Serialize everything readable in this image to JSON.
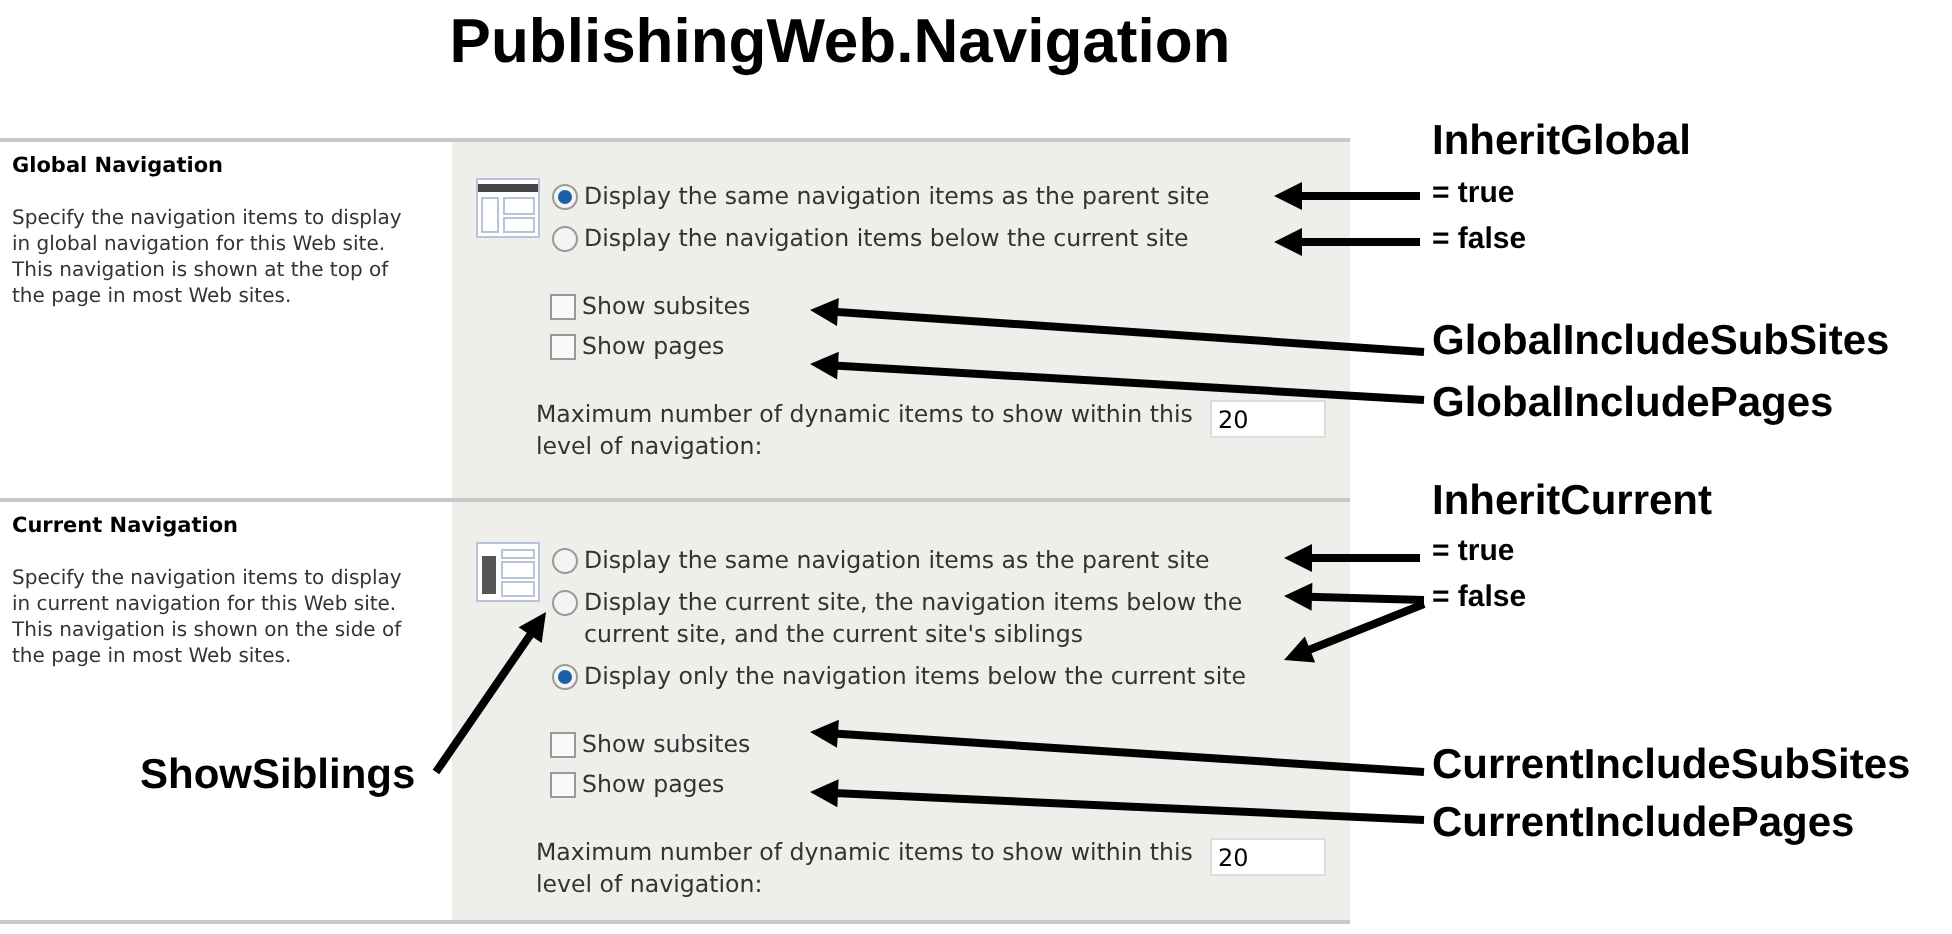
{
  "title": "PublishingWeb.Navigation",
  "sections": [
    {
      "kind": "global",
      "heading": "Global Navigation",
      "description": "Specify the navigation items to display in global navigation for this Web site. This navigation is shown at the top of the page in most Web sites.",
      "options": [
        {
          "label": "Display the same navigation items as the parent site",
          "selected": true
        },
        {
          "label": "Display the navigation items below the current site",
          "selected": false
        }
      ],
      "checkboxes": [
        {
          "label": "Show subsites",
          "checked": false
        },
        {
          "label": "Show pages",
          "checked": false
        }
      ],
      "max_items": {
        "label": "Maximum number of dynamic items to show within this level of navigation:",
        "value": "20"
      }
    },
    {
      "kind": "current",
      "heading": "Current Navigation",
      "description": "Specify the navigation items to display in current navigation for this Web site. This navigation is shown on the side of the page in most Web sites.",
      "options": [
        {
          "label": "Display the same navigation items as the parent site",
          "selected": false
        },
        {
          "label": "Display the current site, the navigation items below the current site, and the current site's siblings",
          "selected": false
        },
        {
          "label": "Display only the navigation items below the current site",
          "selected": true
        }
      ],
      "checkboxes": [
        {
          "label": "Show subsites",
          "checked": false
        },
        {
          "label": "Show pages",
          "checked": false
        }
      ],
      "max_items": {
        "label": "Maximum number of dynamic items to show within this level of navigation:",
        "value": "20"
      }
    }
  ],
  "annotations": [
    {
      "text": "InheritGlobal",
      "kind": "property"
    },
    {
      "text": "= true",
      "kind": "value"
    },
    {
      "text": "= false",
      "kind": "value"
    },
    {
      "text": "GlobalIncludeSubSites",
      "kind": "property"
    },
    {
      "text": "GlobalIncludePages",
      "kind": "property"
    },
    {
      "text": "InheritCurrent",
      "kind": "property"
    },
    {
      "text": "= true",
      "kind": "value"
    },
    {
      "text": "= false",
      "kind": "value"
    },
    {
      "text": "ShowSiblings",
      "kind": "callout"
    },
    {
      "text": "CurrentIncludeSubSites",
      "kind": "property"
    },
    {
      "text": "CurrentIncludePages",
      "kind": "property"
    }
  ]
}
